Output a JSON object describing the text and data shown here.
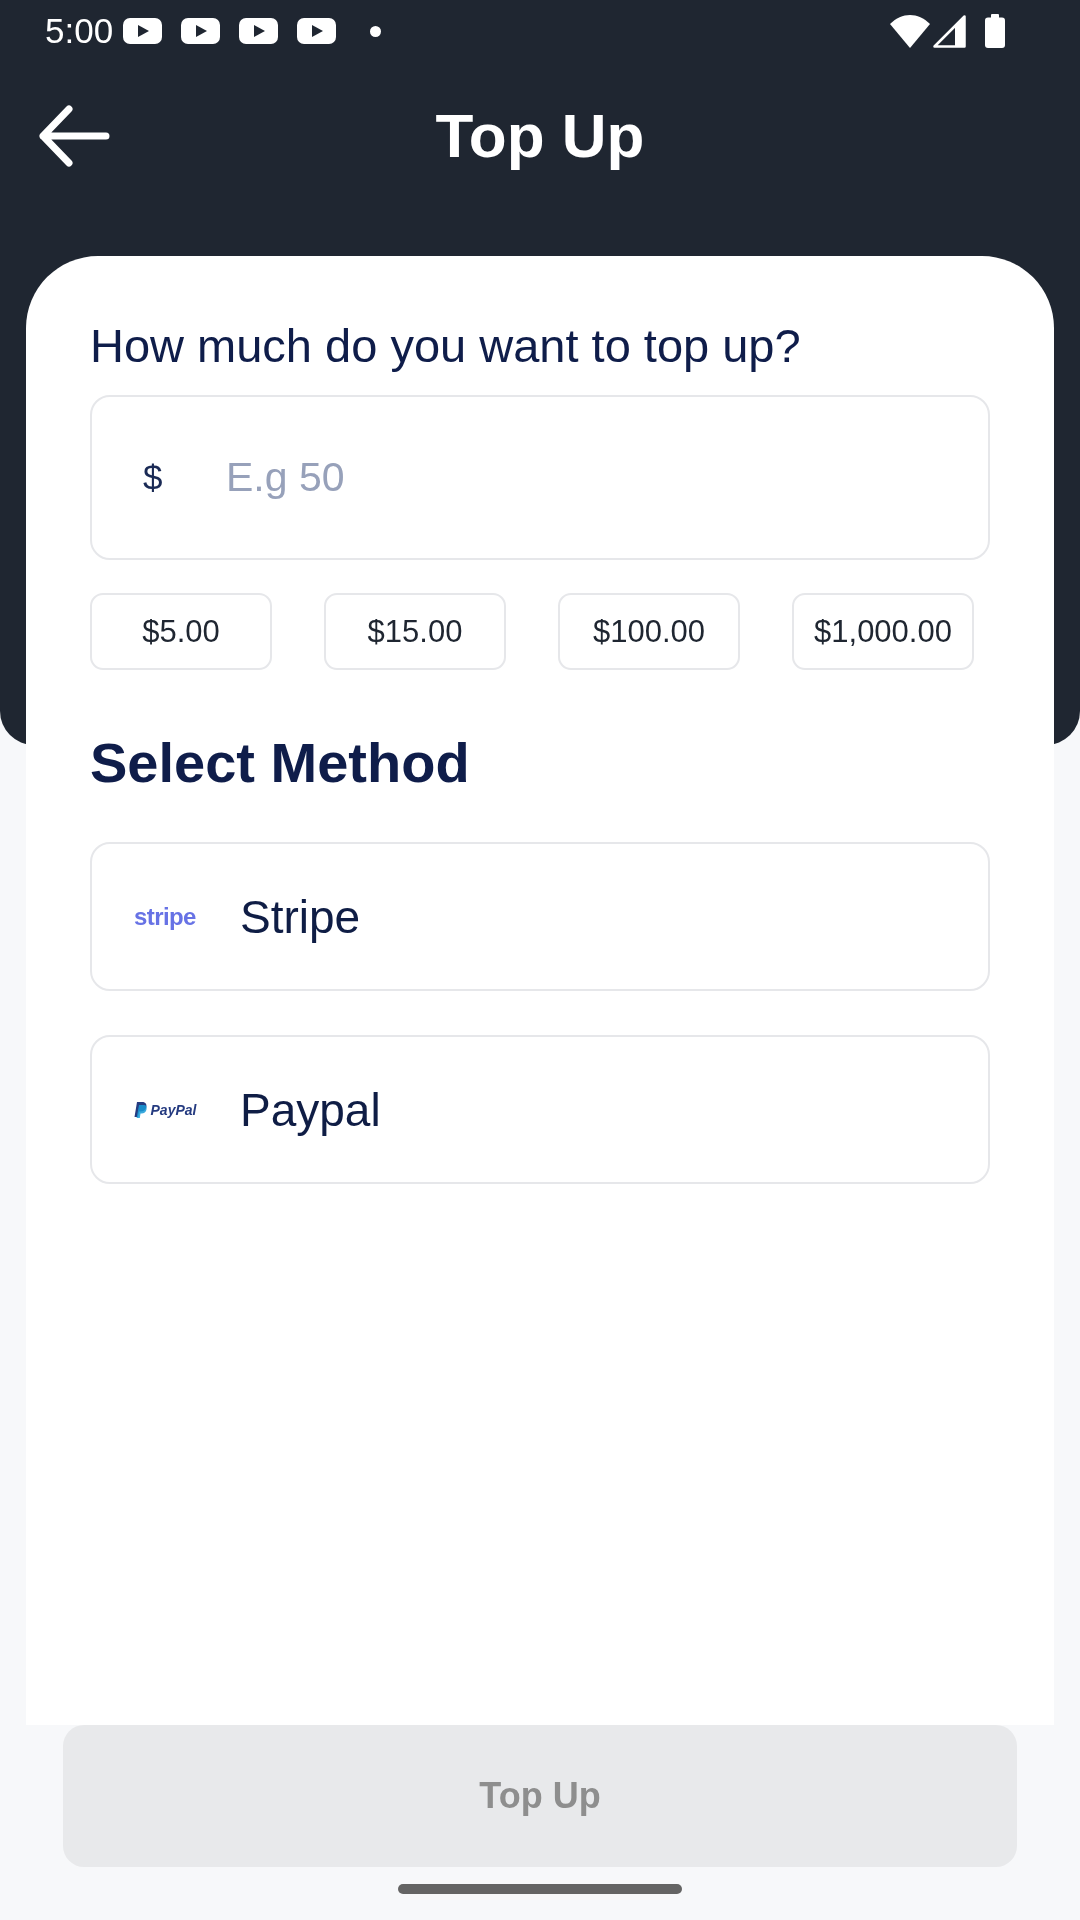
{
  "status_bar": {
    "time": "5:00"
  },
  "header": {
    "title": "Top Up"
  },
  "amount": {
    "label": "How much do you want to top up?",
    "currency": "$",
    "placeholder": "E.g 50"
  },
  "presets": [
    "$5.00",
    "$15.00",
    "$100.00",
    "$1,000.00"
  ],
  "section_title": "Select Method",
  "methods": [
    {
      "kind": "stripe",
      "logo": "stripe",
      "name": "Stripe",
      "selected": false
    },
    {
      "kind": "paypal",
      "logo": "PayPal",
      "name": "Paypal",
      "selected": false
    }
  ],
  "submit": {
    "label": "Top Up",
    "disabled": true
  }
}
